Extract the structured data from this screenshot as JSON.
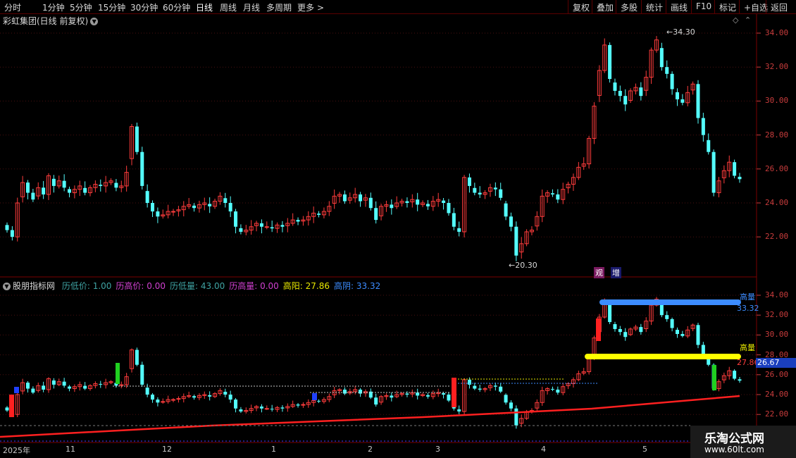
{
  "toolbar": {
    "periods": [
      "分时",
      "1分钟",
      "5分钟",
      "15分钟",
      "30分钟",
      "60分钟",
      "日线",
      "周线",
      "月线",
      "多周期",
      "更多"
    ],
    "active_period": "日线",
    "right_buttons": [
      "复权",
      "叠加",
      "多股",
      "统计",
      "画线",
      "F10",
      "标记",
      "+自选",
      "返回"
    ]
  },
  "main_panel": {
    "title": "彩虹集团(日线 前复权)",
    "high_label": "34.30",
    "low_label": "20.30",
    "badge_left": "观",
    "badge_right": "增",
    "price_axis": [
      "34.00",
      "32.00",
      "30.00",
      "28.00",
      "26.00",
      "24.00",
      "22.00"
    ]
  },
  "indicator_panel": {
    "name": "股朋指标网",
    "items": [
      {
        "label": "历低价:",
        "value": "1.00",
        "color": "#3fa3a3"
      },
      {
        "label": "历高价:",
        "value": "0.00",
        "color": "#d040d0"
      },
      {
        "label": "历低量:",
        "value": "43.00",
        "color": "#3fa3a3"
      },
      {
        "label": "历高量:",
        "value": "0.00",
        "color": "#d040d0"
      },
      {
        "label": "高阳:",
        "value": "27.86",
        "color": "#e8e800"
      },
      {
        "label": "高阴:",
        "value": "33.32",
        "color": "#3c8cff"
      }
    ],
    "price_axis": [
      "34.00",
      "32.00",
      "30.00",
      "28.00",
      "26.00",
      "24.00",
      "22.00"
    ],
    "current_price": "26.67",
    "yellow_line_value": "27.86",
    "blue_line_value": "33.32",
    "yellow_line_label": "高量",
    "blue_line_label": "高量"
  },
  "date_axis": {
    "year": "2025年",
    "months": [
      "11",
      "12",
      "1",
      "2",
      "3",
      "4",
      "5"
    ]
  },
  "watermark": {
    "line1": "乐淘公式网",
    "line2": "www.60lt.com"
  },
  "colors": {
    "up": "#ff3c3c",
    "down": "#54ffff",
    "grid": "#5a1a1a",
    "axis_text": "#c83c3c",
    "yellow": "#ffff00",
    "blue": "#3c8cff",
    "rise_line": "#ff2020"
  },
  "chart_data": {
    "type": "candlestick",
    "title": "彩虹集团(日线 前复权)",
    "ylim": [
      21,
      35
    ],
    "period_high": 34.3,
    "period_low": 20.3,
    "close": [
      22.4,
      22.0,
      24.0,
      25.2,
      24.6,
      24.2,
      24.9,
      24.5,
      25.6,
      25.0,
      25.3,
      24.9,
      24.6,
      24.8,
      25.0,
      24.6,
      24.9,
      25.1,
      25.0,
      25.2,
      25.3,
      24.9,
      25.0,
      25.8,
      28.5,
      27.0,
      25.0,
      24.0,
      23.5,
      23.2,
      23.3,
      23.5,
      23.5,
      23.6,
      23.8,
      23.9,
      23.7,
      23.9,
      24.0,
      23.8,
      24.1,
      24.4,
      24.0,
      23.5,
      22.6,
      22.3,
      22.4,
      22.6,
      22.8,
      22.6,
      22.6,
      22.5,
      22.7,
      22.6,
      22.8,
      23.0,
      22.9,
      23.0,
      23.2,
      23.4,
      23.3,
      23.5,
      23.8,
      24.4,
      24.5,
      24.1,
      24.3,
      24.5,
      24.1,
      24.3,
      23.7,
      23.0,
      23.8,
      23.9,
      23.7,
      24.0,
      24.1,
      24.0,
      24.2,
      23.9,
      24.0,
      23.8,
      24.1,
      24.2,
      24.0,
      23.4,
      22.6,
      22.3,
      25.5,
      25.0,
      24.6,
      24.5,
      24.6,
      24.9,
      24.8,
      24.3,
      23.2,
      22.6,
      20.9,
      21.6,
      22.3,
      22.4,
      23.2,
      24.4,
      24.6,
      24.5,
      24.2,
      24.8,
      25.1,
      25.5,
      26.1,
      26.3,
      27.8,
      29.7,
      31.8,
      33.3,
      31.3,
      30.6,
      30.3,
      29.8,
      30.6,
      30.8,
      30.3,
      31.4,
      33.0,
      33.6,
      32.0,
      31.6,
      30.7,
      30.1,
      29.9,
      30.5,
      31.0,
      29.0,
      28.0,
      27.0,
      24.6,
      25.3,
      25.9,
      26.4,
      25.6,
      25.4
    ]
  }
}
